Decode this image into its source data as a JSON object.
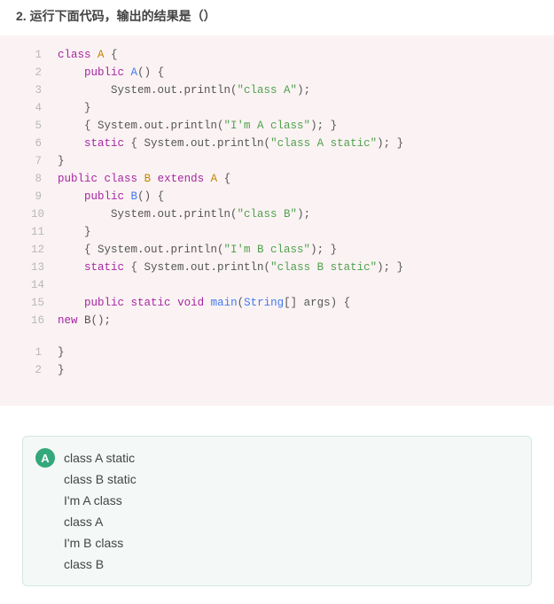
{
  "question": {
    "num": "2.",
    "text": "运行下面代码，输出的结果是（）"
  },
  "code1": [
    {
      "n": "1",
      "t": [
        {
          "c": "kw",
          "s": "class"
        },
        {
          "c": "",
          "s": " "
        },
        {
          "c": "cls",
          "s": "A"
        },
        {
          "c": "",
          "s": " {"
        }
      ]
    },
    {
      "n": "2",
      "t": [
        {
          "c": "",
          "s": "    "
        },
        {
          "c": "kw",
          "s": "public"
        },
        {
          "c": "",
          "s": " "
        },
        {
          "c": "fn",
          "s": "A"
        },
        {
          "c": "",
          "s": "() {"
        }
      ]
    },
    {
      "n": "3",
      "t": [
        {
          "c": "",
          "s": "        System.out.println("
        },
        {
          "c": "str",
          "s": "\"class A\""
        },
        {
          "c": "",
          "s": ");"
        }
      ]
    },
    {
      "n": "4",
      "t": [
        {
          "c": "",
          "s": "    }"
        }
      ]
    },
    {
      "n": "5",
      "t": [
        {
          "c": "",
          "s": "    { System.out.println("
        },
        {
          "c": "str",
          "s": "\"I'm A class\""
        },
        {
          "c": "",
          "s": "); }"
        }
      ]
    },
    {
      "n": "6",
      "t": [
        {
          "c": "",
          "s": "    "
        },
        {
          "c": "kw",
          "s": "static"
        },
        {
          "c": "",
          "s": " { System.out.println("
        },
        {
          "c": "str",
          "s": "\"class A static\""
        },
        {
          "c": "",
          "s": "); }"
        }
      ]
    },
    {
      "n": "7",
      "t": [
        {
          "c": "",
          "s": "}"
        }
      ]
    },
    {
      "n": "8",
      "t": [
        {
          "c": "kw",
          "s": "public"
        },
        {
          "c": "",
          "s": " "
        },
        {
          "c": "kw",
          "s": "class"
        },
        {
          "c": "",
          "s": " "
        },
        {
          "c": "cls",
          "s": "B"
        },
        {
          "c": "",
          "s": " "
        },
        {
          "c": "kw",
          "s": "extends"
        },
        {
          "c": "",
          "s": " "
        },
        {
          "c": "cls",
          "s": "A"
        },
        {
          "c": "",
          "s": " {"
        }
      ]
    },
    {
      "n": "9",
      "t": [
        {
          "c": "",
          "s": "    "
        },
        {
          "c": "kw",
          "s": "public"
        },
        {
          "c": "",
          "s": " "
        },
        {
          "c": "fn",
          "s": "B"
        },
        {
          "c": "",
          "s": "() {"
        }
      ]
    },
    {
      "n": "10",
      "t": [
        {
          "c": "",
          "s": "        System.out.println("
        },
        {
          "c": "str",
          "s": "\"class B\""
        },
        {
          "c": "",
          "s": ");"
        }
      ]
    },
    {
      "n": "11",
      "t": [
        {
          "c": "",
          "s": "    }"
        }
      ]
    },
    {
      "n": "12",
      "t": [
        {
          "c": "",
          "s": "    { System.out.println("
        },
        {
          "c": "str",
          "s": "\"I'm B class\""
        },
        {
          "c": "",
          "s": "); }"
        }
      ]
    },
    {
      "n": "13",
      "t": [
        {
          "c": "",
          "s": "    "
        },
        {
          "c": "kw",
          "s": "static"
        },
        {
          "c": "",
          "s": " { System.out.println("
        },
        {
          "c": "str",
          "s": "\"class B static\""
        },
        {
          "c": "",
          "s": "); }"
        }
      ]
    },
    {
      "n": "14",
      "t": [
        {
          "c": "",
          "s": ""
        }
      ]
    },
    {
      "n": "15",
      "t": [
        {
          "c": "",
          "s": "    "
        },
        {
          "c": "kw",
          "s": "public"
        },
        {
          "c": "",
          "s": " "
        },
        {
          "c": "kw",
          "s": "static"
        },
        {
          "c": "",
          "s": " "
        },
        {
          "c": "kw",
          "s": "void"
        },
        {
          "c": "",
          "s": " "
        },
        {
          "c": "fn",
          "s": "main"
        },
        {
          "c": "",
          "s": "("
        },
        {
          "c": "typ",
          "s": "String"
        },
        {
          "c": "",
          "s": "[] args) {"
        }
      ]
    },
    {
      "n": "16",
      "t": [
        {
          "c": "kw",
          "s": "new"
        },
        {
          "c": "",
          "s": " B();"
        }
      ]
    }
  ],
  "code2": [
    {
      "n": "1",
      "t": [
        {
          "c": "",
          "s": "}"
        }
      ]
    },
    {
      "n": "2",
      "t": [
        {
          "c": "",
          "s": "}"
        }
      ]
    }
  ],
  "answer": {
    "label": "A",
    "lines": [
      "class A static",
      "class B static",
      "I'm A class",
      "class A",
      "I'm B class",
      "class B"
    ]
  }
}
